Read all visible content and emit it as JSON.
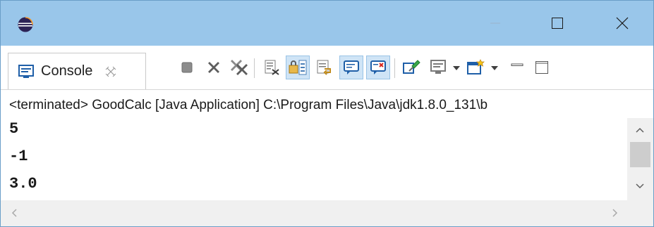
{
  "window": {
    "app_icon": "eclipse-icon",
    "controls": [
      "minimize-icon",
      "maximize-icon",
      "close-icon"
    ]
  },
  "view": {
    "tab_label": "Console",
    "tab_icon": "console-icon",
    "tab_close_icon": "close-icon",
    "toolbar": [
      "terminate-icon",
      "remove-launch-icon",
      "remove-all-terminated-icon",
      "clear-console-icon",
      "scroll-lock-icon",
      "word-wrap-icon",
      "show-on-stdout-icon",
      "show-on-stderr-icon",
      "pin-console-icon",
      "display-selected-console-icon",
      "open-console-icon",
      "minimize-view-icon",
      "maximize-view-icon"
    ]
  },
  "status": "<terminated> GoodCalc [Java Application] C:\\Program Files\\Java\\jdk1.8.0_131\\b",
  "output_lines": [
    "5",
    "-1",
    "3.0"
  ],
  "colors": {
    "titlebar": "#99c6ea",
    "pressed": "#cfe4f6",
    "accent": "#4a90d9"
  }
}
